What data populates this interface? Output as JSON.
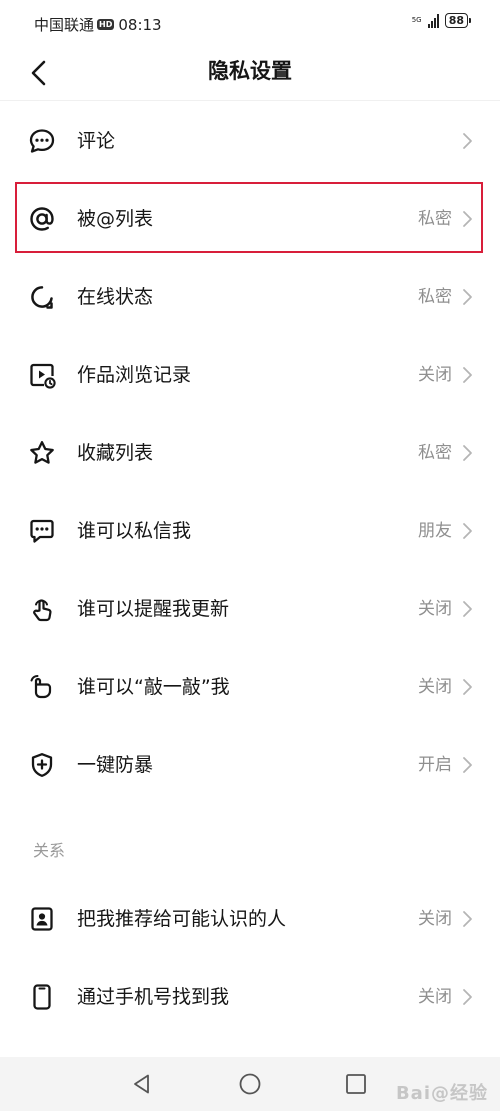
{
  "status_bar": {
    "carrier": "中国联通",
    "hd": "HD",
    "time": "08:13",
    "network": "5G",
    "battery": "88"
  },
  "header": {
    "title": "隐私设置"
  },
  "items": [
    {
      "label": "评论",
      "value": ""
    },
    {
      "label": "被@列表",
      "value": "私密"
    },
    {
      "label": "在线状态",
      "value": "私密"
    },
    {
      "label": "作品浏览记录",
      "value": "关闭"
    },
    {
      "label": "收藏列表",
      "value": "私密"
    },
    {
      "label": "谁可以私信我",
      "value": "朋友"
    },
    {
      "label": "谁可以提醒我更新",
      "value": "关闭"
    },
    {
      "label": "谁可以“敲一敲”我",
      "value": "关闭"
    },
    {
      "label": "一键防暴",
      "value": "开启"
    }
  ],
  "relations": {
    "title": "关系",
    "items": [
      {
        "label": "把我推荐给可能认识的人",
        "value": "关闭"
      },
      {
        "label": "通过手机号找到我",
        "value": "关闭"
      }
    ]
  },
  "watermark": "Bai@经验",
  "colors": {
    "highlight": "#d81e3a",
    "secondary_text": "#8f8f8f"
  }
}
